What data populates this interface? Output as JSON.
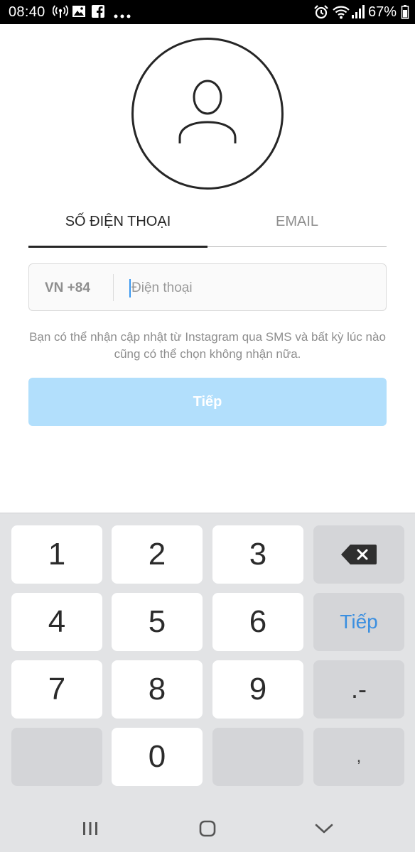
{
  "status_bar": {
    "time": "08:40",
    "battery_percent": "67%",
    "left_icons": [
      "hotspot-icon",
      "image-icon",
      "facebook-icon",
      "more-dots-icon"
    ],
    "right_icons": [
      "alarm-icon",
      "wifi-icon",
      "signal-icon",
      "battery-icon"
    ]
  },
  "signup": {
    "avatar_icon": "user-icon",
    "tabs": [
      {
        "label": "SỐ ĐIỆN THOẠI",
        "active": true
      },
      {
        "label": "EMAIL",
        "active": false
      }
    ],
    "phone": {
      "country_code": "VN +84",
      "placeholder": "Điện thoại",
      "value": ""
    },
    "info_text": "Bạn có thể nhận cập nhật từ Instagram qua SMS và bất kỳ lúc nào cũng có thể chọn không nhận nữa.",
    "next_button": "Tiếp",
    "colors": {
      "button_disabled": "#b2dffc",
      "active_tab": "#262626",
      "inactive_tab": "#8e8e8e",
      "caret": "#3897f0"
    }
  },
  "keyboard": {
    "keys": {
      "k1": "1",
      "k2": "2",
      "k3": "3",
      "k4": "4",
      "k5": "5",
      "k6": "6",
      "k7": "7",
      "k8": "8",
      "k9": "9",
      "k0": "0",
      "next": "Tiếp",
      "punct": ".-",
      "comma": ","
    },
    "backspace_icon": "backspace-icon",
    "next_color": "#3b8fe0"
  },
  "nav_bar": {
    "icons": [
      "recents-icon",
      "home-icon",
      "back-icon"
    ]
  }
}
